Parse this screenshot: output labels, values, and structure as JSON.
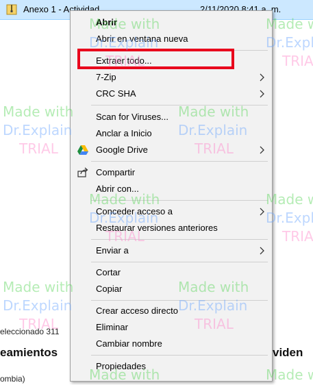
{
  "explorer": {
    "file_name": "Anexo 1 - Actividad",
    "file_date": "2/11/2020 8:41 a. m.",
    "status": "eleccionado  311",
    "heading_left": "eamientos",
    "heading_right": "viden",
    "footer": "ombia)"
  },
  "menu": {
    "open": "Abrir",
    "open_new_window": "Abrir en ventana nueva",
    "extract_all": "Extraer todo...",
    "seven_zip": "7-Zip",
    "crc_sha": "CRC SHA",
    "scan_viruses": "Scan for Viruses...",
    "pin_start": "Anclar a Inicio",
    "google_drive": "Google Drive",
    "share": "Compartir",
    "open_with": "Abrir con...",
    "grant_access": "Conceder acceso a",
    "restore_versions": "Restaurar versiones anteriores",
    "send_to": "Enviar a",
    "cut": "Cortar",
    "copy": "Copiar",
    "create_shortcut": "Crear acceso directo",
    "delete": "Eliminar",
    "rename": "Cambiar nombre",
    "properties": "Propiedades"
  },
  "watermark": {
    "line1": "Made with",
    "line2": "Dr.Explain",
    "line3": "TRIAL"
  },
  "colors": {
    "highlight_border": "#e8001c",
    "selection_bg": "#cce8ff",
    "menu_bg": "#f2f2f2"
  }
}
